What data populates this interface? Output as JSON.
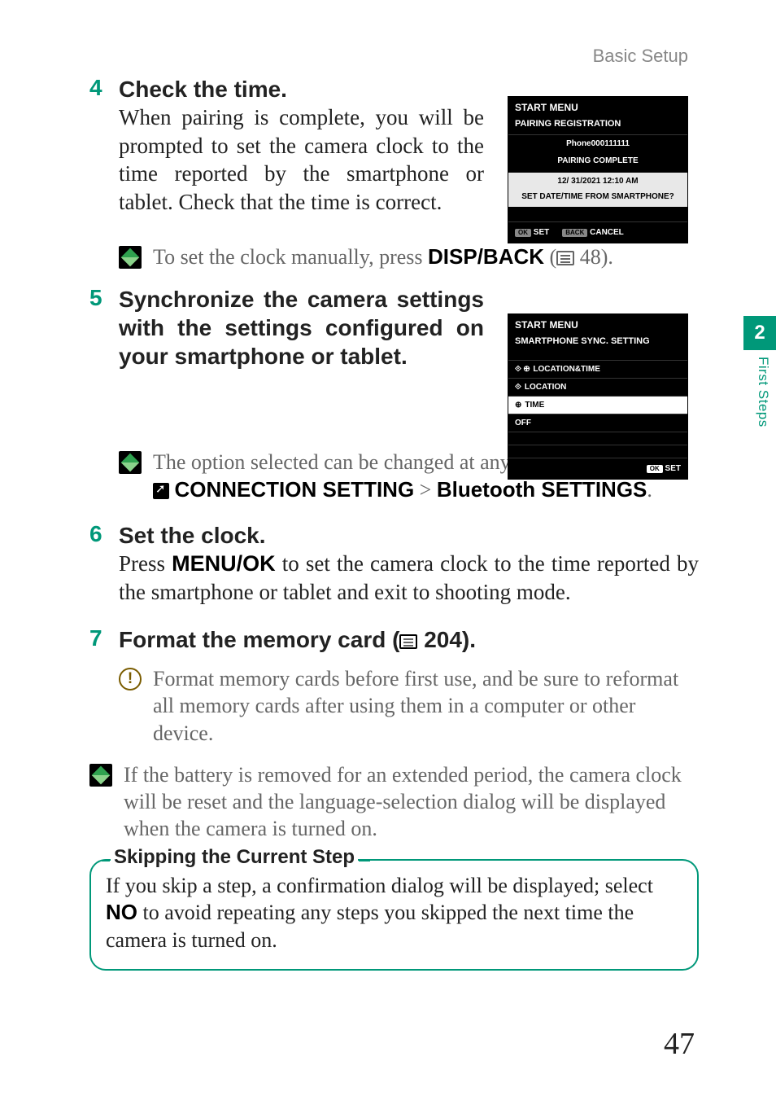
{
  "header": {
    "section": "Basic Setup"
  },
  "sideTab": {
    "number": "2",
    "label": "First Steps"
  },
  "steps": {
    "s4": {
      "num": "4",
      "title": "Check the time.",
      "text": "When pairing is complete, you will be prompted to set the camera clock to the time reported by the smartphone or tablet. Check that the time is correct."
    },
    "note4": {
      "prefix": "To set the clock manually, press ",
      "bold": "DISP/BACK",
      "suffix": " (",
      "page": " 48)."
    },
    "s5": {
      "num": "5",
      "title": "Synchronize the camera settings with the settings configured on your smartphone or tablet."
    },
    "note5": {
      "line1": "The option selected can be changed at any time using ",
      "bold1": "CONNECTION SETTING",
      "mid": " > ",
      "bold2": "Bluetooth SETTINGS",
      "end": "."
    },
    "s6": {
      "num": "6",
      "title": "Set the clock.",
      "prefix": "Press ",
      "bold": "MENU/OK",
      "suffix": " to set the camera clock to the time reported by the smartphone or tablet and exit to shooting mode."
    },
    "s7": {
      "num": "7",
      "titlePrefix": "Format the memory card (",
      "titleSuffix": " 204)."
    },
    "note7": {
      "text": "Format memory cards before first use, and be sure to reformat all memory cards after using them in a computer or other device."
    },
    "finalNote": {
      "text": "If the battery is removed for an extended period, the camera clock will be reset and the language-selection dialog will be displayed when the camera is turned on."
    },
    "box": {
      "title": "Skipping the Current Step",
      "prefix": "If you skip a step, a confirmation dialog will be displayed; select ",
      "bold": "NO",
      "suffix": " to avoid repeating any steps you skipped the next time the camera is turned on."
    }
  },
  "screens": {
    "ss1": {
      "title": "START MENU",
      "subtitle": "PAIRING REGISTRATION",
      "device": "Phone000111111",
      "status": "PAIRING COMPLETE",
      "datetime": "12/ 31/2021 12:10 AM",
      "prompt": "SET DATE/TIME FROM SMARTPHONE?",
      "btnOkKey": "OK",
      "btnOk": "SET",
      "btnCancelKey": "BACK",
      "btnCancel": "CANCEL"
    },
    "ss2": {
      "title": "START MENU",
      "subtitle": "SMARTPHONE SYNC. SETTING",
      "opt1": "LOCATION&TIME",
      "opt2": "LOCATION",
      "opt3": "TIME",
      "opt4": "OFF",
      "btnOkKey": "OK",
      "btnOk": "SET"
    }
  },
  "pageNumber": "47"
}
